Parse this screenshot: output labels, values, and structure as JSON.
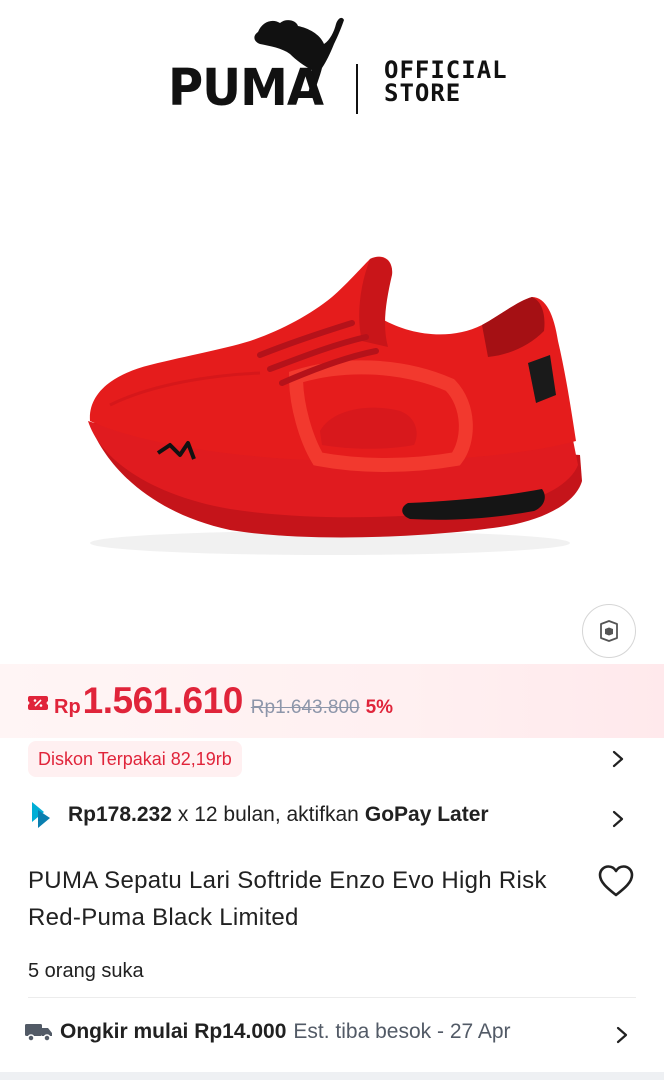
{
  "brand": {
    "wordmark": "PUMA",
    "subtitle_line1": "OFFICIAL",
    "subtitle_line2": "STORE"
  },
  "colors": {
    "accent": "#e0243a",
    "price_bg": "#fff0f1",
    "muted": "#8d96aa",
    "gopay": "#00aed6",
    "shoe": "#e51c1c"
  },
  "product_image": {
    "alt": "Red PUMA Softride Enzo Evo running shoe",
    "ar_icon": "view-in-room-icon"
  },
  "price": {
    "coupon_icon": "coupon-icon",
    "currency": "Rp",
    "current": "1.561.610",
    "original": "Rp1.643.800",
    "discount": "5%"
  },
  "discount_badge": {
    "label": "Diskon Terpakai 82,19rb"
  },
  "paylater": {
    "amount": "Rp178.232",
    "text": "x 12 bulan, aktifkan",
    "provider": "GoPay Later",
    "icon": "gopay-icon"
  },
  "product": {
    "title": "PUMA Sepatu Lari Softride Enzo Evo High Risk Red-Puma Black Limited",
    "likes": "5 orang suka"
  },
  "shipping": {
    "icon": "truck-icon",
    "label": "Ongkir mulai Rp14.000",
    "estimate": "Est. tiba besok - 27 Apr"
  }
}
